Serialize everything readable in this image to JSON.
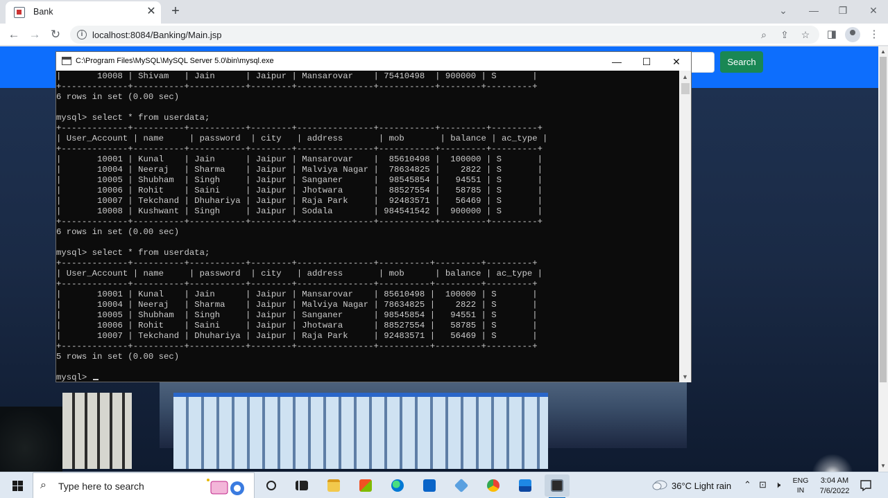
{
  "browser": {
    "tab_title": "Bank",
    "tab_close": "✕",
    "new_tab": "+",
    "url": "localhost:8084/Banking/Main.jsp",
    "window_controls": {
      "chevron": "⌄",
      "minimize": "—",
      "restore": "❐",
      "close": "✕"
    }
  },
  "page": {
    "search_button": "Search"
  },
  "console": {
    "title": "C:\\Program Files\\MySQL\\MySQL Server 5.0\\bin\\mysql.exe",
    "lines": [
      "|       10008 | Shivam   | Jain      | Jaipur | Mansarovar    | 75410498  | 900000 | S       |",
      "+-------------+----------+-----------+--------+---------------+-----------+--------+---------+",
      "6 rows in set (0.00 sec)",
      "",
      "mysql> select * from userdata;",
      "+-------------+----------+-----------+--------+---------------+-----------+---------+---------+",
      "| User_Account | name     | password  | city   | address       | mob       | balance | ac_type |",
      "+-------------+----------+-----------+--------+---------------+-----------+---------+---------+",
      "|       10001 | Kunal    | Jain      | Jaipur | Mansarovar    |  85610498 |  100000 | S       |",
      "|       10004 | Neeraj   | Sharma    | Jaipur | Malviya Nagar |  78634825 |    2822 | S       |",
      "|       10005 | Shubham  | Singh     | Jaipur | Sanganer      |  98545854 |   94551 | S       |",
      "|       10006 | Rohit    | Saini     | Jaipur | Jhotwara      |  88527554 |   58785 | S       |",
      "|       10007 | Tekchand | Dhuhariya | Jaipur | Raja Park     |  92483571 |   56469 | S       |",
      "|       10008 | Kushwant | Singh     | Jaipur | Sodala        | 984541542 |  900000 | S       |",
      "+-------------+----------+-----------+--------+---------------+-----------+---------+---------+",
      "6 rows in set (0.00 sec)",
      "",
      "mysql> select * from userdata;",
      "+-------------+----------+-----------+--------+---------------+----------+---------+---------+",
      "| User_Account | name     | password  | city   | address       | mob      | balance | ac_type |",
      "+-------------+----------+-----------+--------+---------------+----------+---------+---------+",
      "|       10001 | Kunal    | Jain      | Jaipur | Mansarovar    | 85610498 |  100000 | S       |",
      "|       10004 | Neeraj   | Sharma    | Jaipur | Malviya Nagar | 78634825 |    2822 | S       |",
      "|       10005 | Shubham  | Singh     | Jaipur | Sanganer      | 98545854 |   94551 | S       |",
      "|       10006 | Rohit    | Saini     | Jaipur | Jhotwara      | 88527554 |   58785 | S       |",
      "|       10007 | Tekchand | Dhuhariya | Jaipur | Raja Park     | 92483571 |   56469 | S       |",
      "+-------------+----------+-----------+--------+---------------+----------+---------+---------+",
      "5 rows in set (0.00 sec)",
      "",
      "mysql> "
    ],
    "window_controls": {
      "minimize": "—",
      "maximize": "☐",
      "close": "✕"
    }
  },
  "taskbar": {
    "search_placeholder": "Type here to search",
    "weather": "36°C  Light rain",
    "lang_top": "ENG",
    "lang_bottom": "IN",
    "time": "3:04 AM",
    "date": "7/6/2022"
  },
  "colors": {
    "navbar": "#0d6efd",
    "search_button": "#198754",
    "console_bg": "#0c0c0c",
    "console_text": "#cccccc"
  }
}
